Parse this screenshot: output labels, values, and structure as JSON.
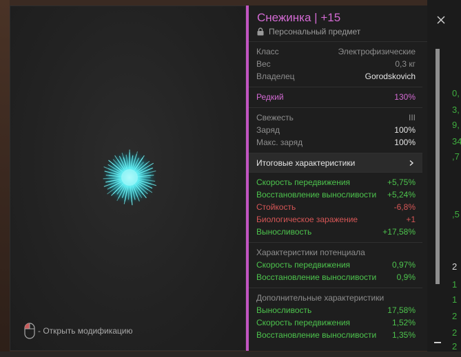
{
  "item": {
    "title": "Снежинка | +15",
    "subtitle": "Персональный предмет"
  },
  "hint": {
    "text": "- Открыть модификацию",
    "mouse_icon": "mouse-icon"
  },
  "basic": {
    "class_label": "Класс",
    "class_value": "Электрофизические",
    "weight_label": "Вес",
    "weight_value": "0,3 кг",
    "owner_label": "Владелец",
    "owner_value": "Gorodskovich"
  },
  "rarity": {
    "label": "Редкий",
    "value": "130%"
  },
  "state": {
    "freshness_label": "Свежесть",
    "freshness_value": "III",
    "charge_label": "Заряд",
    "charge_value": "100%",
    "max_charge_label": "Макс. заряд",
    "max_charge_value": "100%"
  },
  "total_stats": {
    "header": "Итоговые характеристики",
    "rows": [
      {
        "label": "Скорость передвижения",
        "value": "+5,75%"
      },
      {
        "label": "Восстановление выносливости",
        "value": "+5,24%"
      },
      {
        "label": "Стойкость",
        "value": "-6,8%"
      },
      {
        "label": "Биологическое заражение",
        "value": "+1"
      },
      {
        "label": "Выносливость",
        "value": "+17,58%"
      }
    ]
  },
  "potential": {
    "header": "Характеристики потенциала",
    "rows": [
      {
        "label": "Скорость передвижения",
        "value": "0,97%"
      },
      {
        "label": "Восстановление выносливости",
        "value": "0,9%"
      }
    ]
  },
  "extra": {
    "header": "Дополнительные характеристики",
    "rows": [
      {
        "label": "Выносливость",
        "value": "17,58%"
      },
      {
        "label": "Скорость передвижения",
        "value": "1,52%"
      },
      {
        "label": "Восстановление выносливости",
        "value": "1,35%"
      }
    ]
  },
  "background_right": {
    "snippets": [
      "0,",
      "3,",
      "9,",
      "34",
      ",7",
      ",5",
      "2",
      "1",
      "1",
      "2",
      "2",
      "2"
    ]
  },
  "colors": {
    "accent": "#c255c2",
    "positive": "#4dc44d",
    "negative": "#d65656"
  }
}
